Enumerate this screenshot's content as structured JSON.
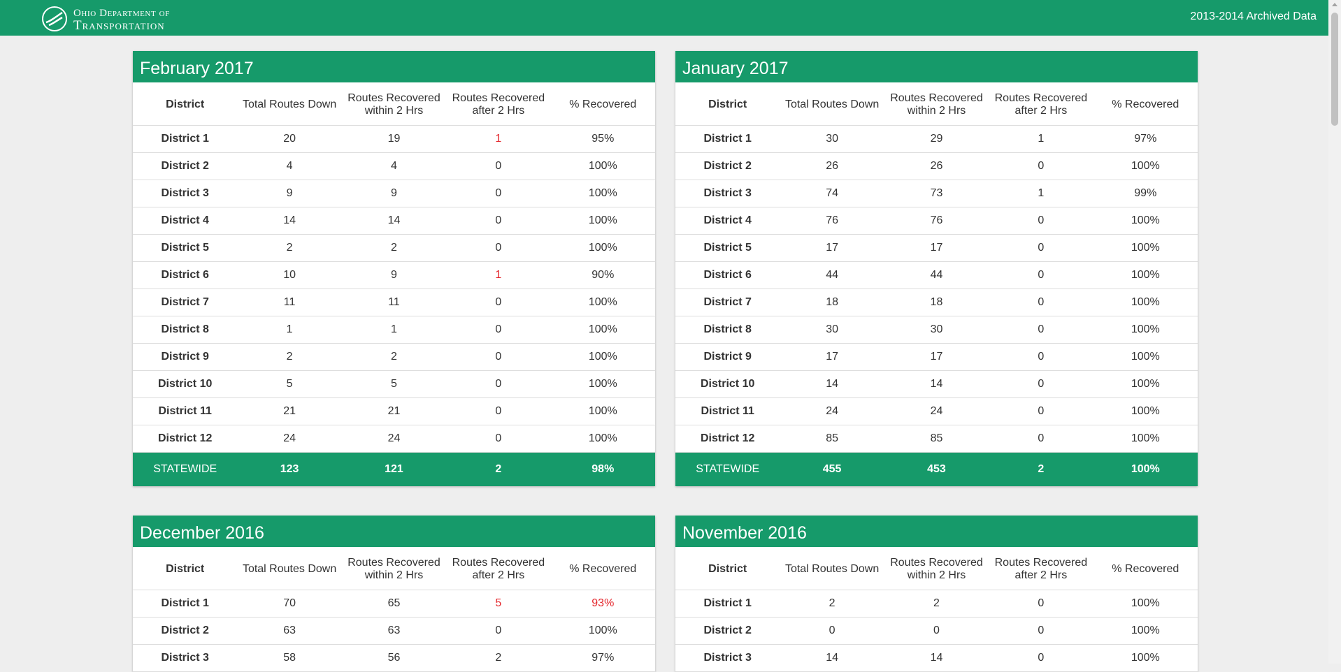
{
  "header": {
    "logo_line1": "Ohio Department of",
    "logo_line2": "Transportation",
    "archived_link": "2013-2014 Archived Data"
  },
  "columns": [
    "District",
    "Total Routes Down",
    "Routes Recovered within 2 Hrs",
    "Routes Recovered after 2 Hrs",
    "% Recovered"
  ],
  "colors": {
    "brand_green": "#169a6a",
    "alert_red": "#e4262c"
  },
  "panels": [
    {
      "title": "February 2017",
      "rows": [
        {
          "district": "District 1",
          "total": "20",
          "within": "19",
          "after": "1",
          "pct": "95%",
          "after_red": true,
          "pct_red": false
        },
        {
          "district": "District 2",
          "total": "4",
          "within": "4",
          "after": "0",
          "pct": "100%",
          "after_red": false,
          "pct_red": false
        },
        {
          "district": "District 3",
          "total": "9",
          "within": "9",
          "after": "0",
          "pct": "100%",
          "after_red": false,
          "pct_red": false
        },
        {
          "district": "District 4",
          "total": "14",
          "within": "14",
          "after": "0",
          "pct": "100%",
          "after_red": false,
          "pct_red": false
        },
        {
          "district": "District 5",
          "total": "2",
          "within": "2",
          "after": "0",
          "pct": "100%",
          "after_red": false,
          "pct_red": false
        },
        {
          "district": "District 6",
          "total": "10",
          "within": "9",
          "after": "1",
          "pct": "90%",
          "after_red": true,
          "pct_red": false
        },
        {
          "district": "District 7",
          "total": "11",
          "within": "11",
          "after": "0",
          "pct": "100%",
          "after_red": false,
          "pct_red": false
        },
        {
          "district": "District 8",
          "total": "1",
          "within": "1",
          "after": "0",
          "pct": "100%",
          "after_red": false,
          "pct_red": false
        },
        {
          "district": "District 9",
          "total": "2",
          "within": "2",
          "after": "0",
          "pct": "100%",
          "after_red": false,
          "pct_red": false
        },
        {
          "district": "District 10",
          "total": "5",
          "within": "5",
          "after": "0",
          "pct": "100%",
          "after_red": false,
          "pct_red": false
        },
        {
          "district": "District 11",
          "total": "21",
          "within": "21",
          "after": "0",
          "pct": "100%",
          "after_red": false,
          "pct_red": false
        },
        {
          "district": "District 12",
          "total": "24",
          "within": "24",
          "after": "0",
          "pct": "100%",
          "after_red": false,
          "pct_red": false
        }
      ],
      "statewide": {
        "district": "STATEWIDE",
        "total": "123",
        "within": "121",
        "after": "2",
        "pct": "98%"
      }
    },
    {
      "title": "January 2017",
      "rows": [
        {
          "district": "District 1",
          "total": "30",
          "within": "29",
          "after": "1",
          "pct": "97%",
          "after_red": false,
          "pct_red": false
        },
        {
          "district": "District 2",
          "total": "26",
          "within": "26",
          "after": "0",
          "pct": "100%",
          "after_red": false,
          "pct_red": false
        },
        {
          "district": "District 3",
          "total": "74",
          "within": "73",
          "after": "1",
          "pct": "99%",
          "after_red": false,
          "pct_red": false
        },
        {
          "district": "District 4",
          "total": "76",
          "within": "76",
          "after": "0",
          "pct": "100%",
          "after_red": false,
          "pct_red": false
        },
        {
          "district": "District 5",
          "total": "17",
          "within": "17",
          "after": "0",
          "pct": "100%",
          "after_red": false,
          "pct_red": false
        },
        {
          "district": "District 6",
          "total": "44",
          "within": "44",
          "after": "0",
          "pct": "100%",
          "after_red": false,
          "pct_red": false
        },
        {
          "district": "District 7",
          "total": "18",
          "within": "18",
          "after": "0",
          "pct": "100%",
          "after_red": false,
          "pct_red": false
        },
        {
          "district": "District 8",
          "total": "30",
          "within": "30",
          "after": "0",
          "pct": "100%",
          "after_red": false,
          "pct_red": false
        },
        {
          "district": "District 9",
          "total": "17",
          "within": "17",
          "after": "0",
          "pct": "100%",
          "after_red": false,
          "pct_red": false
        },
        {
          "district": "District 10",
          "total": "14",
          "within": "14",
          "after": "0",
          "pct": "100%",
          "after_red": false,
          "pct_red": false
        },
        {
          "district": "District 11",
          "total": "24",
          "within": "24",
          "after": "0",
          "pct": "100%",
          "after_red": false,
          "pct_red": false
        },
        {
          "district": "District 12",
          "total": "85",
          "within": "85",
          "after": "0",
          "pct": "100%",
          "after_red": false,
          "pct_red": false
        }
      ],
      "statewide": {
        "district": "STATEWIDE",
        "total": "455",
        "within": "453",
        "after": "2",
        "pct": "100%"
      }
    },
    {
      "title": "December 2016",
      "rows": [
        {
          "district": "District 1",
          "total": "70",
          "within": "65",
          "after": "5",
          "pct": "93%",
          "after_red": true,
          "pct_red": true
        },
        {
          "district": "District 2",
          "total": "63",
          "within": "63",
          "after": "0",
          "pct": "100%",
          "after_red": false,
          "pct_red": false
        },
        {
          "district": "District 3",
          "total": "58",
          "within": "56",
          "after": "2",
          "pct": "97%",
          "after_red": false,
          "pct_red": false
        }
      ]
    },
    {
      "title": "November 2016",
      "rows": [
        {
          "district": "District 1",
          "total": "2",
          "within": "2",
          "after": "0",
          "pct": "100%",
          "after_red": false,
          "pct_red": false
        },
        {
          "district": "District 2",
          "total": "0",
          "within": "0",
          "after": "0",
          "pct": "100%",
          "after_red": false,
          "pct_red": false
        },
        {
          "district": "District 3",
          "total": "14",
          "within": "14",
          "after": "0",
          "pct": "100%",
          "after_red": false,
          "pct_red": false
        }
      ]
    }
  ]
}
